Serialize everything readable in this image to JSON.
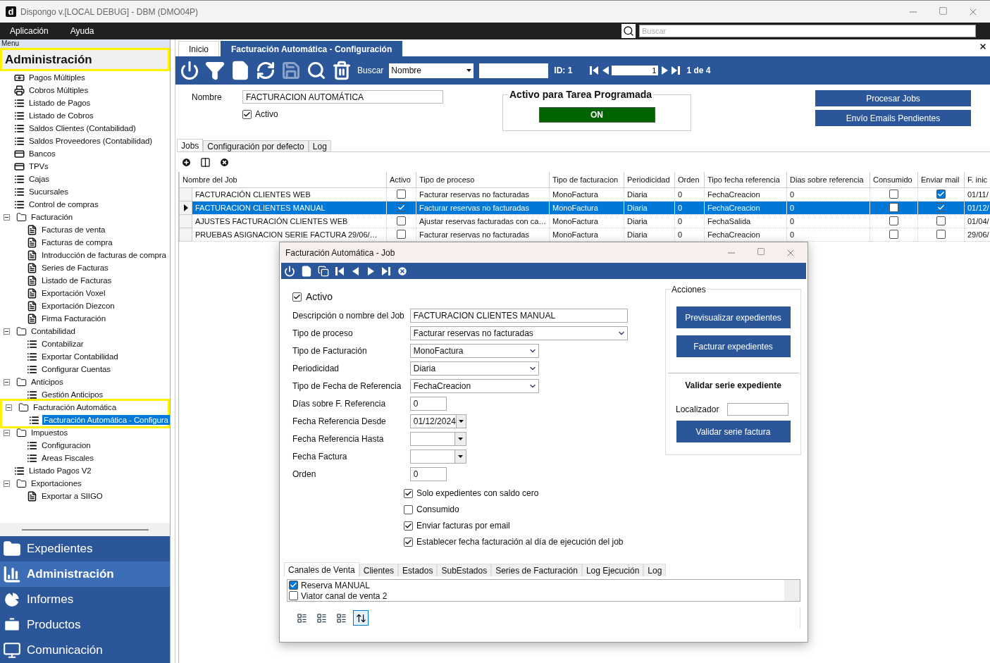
{
  "window": {
    "logo": "d",
    "title": "Dispongo v.[LOCAL DEBUG] - DBM (DMO04P)"
  },
  "menu_bar": {
    "items": [
      "Aplicación",
      "Ayuda"
    ],
    "search": {
      "placeholder": "Buscar"
    }
  },
  "sidebar": {
    "panel_title": "Menu",
    "header": {
      "label": "Administración",
      "highlighted": true
    },
    "tree": [
      {
        "label": "Pagos Múltiples",
        "kind": "money",
        "selected": false
      },
      {
        "label": "Cobros Múltiples",
        "kind": "printer",
        "selected": false
      },
      {
        "label": "Listado de Pagos",
        "kind": "list",
        "selected": false
      },
      {
        "label": "Listado de Cobros",
        "kind": "list",
        "selected": false
      },
      {
        "label": "Saldos Clientes (Contabilidad)",
        "kind": "list",
        "selected": false
      },
      {
        "label": "Saldos Proveedores (Contabilidad)",
        "kind": "list",
        "selected": false
      },
      {
        "label": "Bancos",
        "kind": "card",
        "selected": false
      },
      {
        "label": "TPVs",
        "kind": "card",
        "selected": false
      },
      {
        "label": "Cajas",
        "kind": "list",
        "selected": false
      },
      {
        "label": "Sucursales",
        "kind": "list",
        "selected": false
      },
      {
        "label": "Control de compras",
        "kind": "list",
        "selected": false
      },
      {
        "label": "Facturación",
        "kind": "folder",
        "selected": false,
        "expanded": true,
        "highlighted": false,
        "children": [
          {
            "label": "Facturas de venta",
            "kind": "invoice",
            "selected": false
          },
          {
            "label": "Facturas de compra",
            "kind": "invoice",
            "selected": false
          },
          {
            "label": "Introducción de facturas de compra",
            "kind": "invoice",
            "selected": false
          },
          {
            "label": "Series de Facturas",
            "kind": "invoice",
            "selected": false
          },
          {
            "label": "Listado de Facturas",
            "kind": "invoice",
            "selected": false
          },
          {
            "label": "Exportación Voxel",
            "kind": "invoice",
            "selected": false
          },
          {
            "label": "Exportación Diezcon",
            "kind": "invoice",
            "selected": false
          },
          {
            "label": "Firma Facturación",
            "kind": "invoice",
            "selected": false
          }
        ]
      },
      {
        "label": "Contabilidad",
        "kind": "folder",
        "selected": false,
        "expanded": true,
        "highlighted": false,
        "children": [
          {
            "label": "Contabilizar",
            "kind": "list",
            "selected": false
          },
          {
            "label": "Exportar Contabilidad",
            "kind": "list",
            "selected": false
          },
          {
            "label": "Configurar Cuentas",
            "kind": "list",
            "selected": false
          }
        ]
      },
      {
        "label": "Anticipos",
        "kind": "folder",
        "selected": false,
        "expanded": true,
        "highlighted": false,
        "children": [
          {
            "label": "Gestión Anticipos",
            "kind": "list",
            "selected": false
          }
        ]
      },
      {
        "label": "Facturación Automática",
        "kind": "folder",
        "selected": false,
        "expanded": true,
        "highlighted": true,
        "children": [
          {
            "label": "Facturación Automática - Configura",
            "kind": "list",
            "selected": true
          }
        ]
      },
      {
        "label": "Impuestos",
        "kind": "folder",
        "selected": false,
        "expanded": true,
        "highlighted": false,
        "children": [
          {
            "label": "Configuracion",
            "kind": "list",
            "selected": false
          },
          {
            "label": "Areas Fiscales",
            "kind": "list",
            "selected": false
          }
        ]
      },
      {
        "label": "Listado Pagos V2",
        "kind": "list",
        "selected": false
      },
      {
        "label": "Exportaciones",
        "kind": "folder",
        "selected": false,
        "expanded": true,
        "highlighted": false,
        "children": [
          {
            "label": "Exportar a SIIGO",
            "kind": "invoice",
            "selected": false
          }
        ]
      }
    ],
    "nav": [
      {
        "label": "Expedientes",
        "kind": "folder",
        "selected": false
      },
      {
        "label": "Administración",
        "kind": "chart",
        "selected": true
      },
      {
        "label": "Informes",
        "kind": "pie",
        "selected": false
      },
      {
        "label": "Productos",
        "kind": "briefcase",
        "selected": false
      },
      {
        "label": "Comunicación",
        "kind": "screen",
        "selected": false
      }
    ]
  },
  "tabs": [
    {
      "label": "Inicio",
      "selected": false
    },
    {
      "label": "Facturación Automática - Configuración",
      "selected": true
    }
  ],
  "toolbar": {
    "tools": [
      {
        "kind": "power",
        "disabled": false
      },
      {
        "kind": "filter",
        "disabled": false
      },
      {
        "kind": "new",
        "disabled": false
      },
      {
        "kind": "refresh",
        "disabled": false
      },
      {
        "kind": "save",
        "disabled": true
      },
      {
        "kind": "search",
        "disabled": false
      },
      {
        "kind": "delete",
        "disabled": false
      }
    ],
    "search_label": "Buscar",
    "search_field": "Nombre",
    "id_label": "ID: 1",
    "record": "1",
    "record_count": "1 de 4"
  },
  "form": {
    "name_label": "Nombre",
    "name_value": "FACTURACION AUTOMÁTICA",
    "active": {
      "label": "Activo",
      "checked": true
    },
    "scheduled": {
      "title": "Activo para Tarea Programada",
      "status": "ON",
      "on": true
    },
    "buttons": [
      "Procesar Jobs",
      "Envío Emails Pendientes"
    ]
  },
  "detail_tabs": [
    {
      "label": "Jobs",
      "selected": true
    },
    {
      "label": "Configuración por defecto",
      "selected": false
    },
    {
      "label": "Log",
      "selected": false
    }
  ],
  "jobs_toolbar": [
    {
      "kind": "add"
    },
    {
      "kind": "columns"
    },
    {
      "kind": "remove"
    }
  ],
  "table": {
    "columns": [
      "Nombre del Job",
      "Activo",
      "Tipo de proceso",
      "Tipo de facturacion",
      "Periodicidad",
      "Orden",
      "Tipo fecha referencia",
      "Dias sobre referencia",
      "Consumido",
      "Enviar mail",
      "F. inic"
    ],
    "rows": [
      {
        "selected": false,
        "name": "FACTURACIÓN CLIENTES WEB",
        "active": false,
        "process": "Facturar reservas no facturadas",
        "billing": "MonoFactura",
        "period": "Diaria",
        "order": "0",
        "date_type": "FechaCreacion",
        "days": "0",
        "consumed": false,
        "send_mail": true,
        "start": "01/11/"
      },
      {
        "selected": true,
        "name": "FACTURACION CLIENTES MANUAL",
        "active": true,
        "process": "Facturar reservas no facturadas",
        "billing": "MonoFactura",
        "period": "Diaria",
        "order": "0",
        "date_type": "FechaCreacion",
        "days": "0",
        "consumed": false,
        "send_mail": true,
        "start": "01/12/"
      },
      {
        "selected": false,
        "name": "AJUSTES FACTURACIÓN CLIENTES WEB",
        "active": false,
        "process": "Ajustar reservas facturadas con ca…",
        "billing": "MonoFactura",
        "period": "Diaria",
        "order": "0",
        "date_type": "FechaSalida",
        "days": "0",
        "consumed": false,
        "send_mail": false,
        "start": "01/04/"
      },
      {
        "selected": false,
        "name": "PRUEBAS ASIGNACION SERIE FACTURA 29/06/…",
        "active": false,
        "process": "Facturar reservas no facturadas",
        "billing": "MonoFactura",
        "period": "Diaria",
        "order": "0",
        "date_type": "FechaCreacion",
        "days": "0",
        "consumed": false,
        "send_mail": false,
        "start": "29/06/"
      }
    ]
  },
  "dialog": {
    "title": "Facturación Automática - Job",
    "toolbar": [
      {
        "kind": "power"
      },
      {
        "kind": "new"
      },
      {
        "kind": "copy"
      },
      {
        "kind": "first"
      },
      {
        "kind": "prev"
      },
      {
        "kind": "next"
      },
      {
        "kind": "last"
      },
      {
        "kind": "close"
      }
    ],
    "active": {
      "label": "Activo",
      "checked": true
    },
    "fields": [
      {
        "label": "Descripción o nombre del Job",
        "value": "FACTURACION CLIENTES MANUAL",
        "kind": "text"
      },
      {
        "label": "Tipo de proceso",
        "value": "Facturar reservas no facturadas",
        "kind": "combo"
      },
      {
        "label": "Tipo de Facturación",
        "value": "MonoFactura",
        "kind": "dropdown"
      },
      {
        "label": "Periodicidad",
        "value": "Diaria",
        "kind": "dropdown"
      },
      {
        "label": "Tipo de Fecha de Referencia",
        "value": "FechaCreacion",
        "kind": "dropdown"
      },
      {
        "label": "Días sobre F. Referencia",
        "value": "0",
        "kind": "number"
      },
      {
        "label": "Fecha Referencia Desde",
        "value": "01/12/2024",
        "kind": "date"
      },
      {
        "label": "Fecha Referencia Hasta",
        "kind": "date"
      },
      {
        "label": "Fecha Factura",
        "kind": "date"
      },
      {
        "label": "Orden",
        "value": "0",
        "kind": "number"
      }
    ],
    "options": [
      {
        "label": "Solo expedientes con saldo cero",
        "checked": true
      },
      {
        "label": "Consumido",
        "checked": false
      },
      {
        "label": "Enviar facturas por email",
        "checked": true
      },
      {
        "label": "Establecer fecha facturación al día de ejecución del job",
        "checked": true
      }
    ],
    "actions": {
      "title": "Acciones",
      "buttons": [
        "Previsualizar expedientes",
        "Facturar expedientes"
      ],
      "validate_title": "Validar serie expediente",
      "locator_label": "Localizador",
      "validate_button": "Validar serie factura"
    },
    "tabs": [
      {
        "label": "Canales de Venta",
        "selected": true
      },
      {
        "label": "Clientes",
        "selected": false
      },
      {
        "label": "Estados",
        "selected": false
      },
      {
        "label": "SubEstados",
        "selected": false
      },
      {
        "label": "Series de Facturación",
        "selected": false
      },
      {
        "label": "Log Ejecución",
        "selected": false
      },
      {
        "label": "Log",
        "selected": false
      }
    ],
    "channels": [
      {
        "label": "Reserva MANUAL",
        "checked": true
      },
      {
        "label": "Viator canal de venta 2",
        "checked": false
      }
    ],
    "footer_tools": [
      {
        "kind": "list",
        "selected": false
      },
      {
        "kind": "list",
        "selected": false
      },
      {
        "kind": "list",
        "selected": false
      },
      {
        "kind": "sort",
        "selected": true
      }
    ]
  }
}
